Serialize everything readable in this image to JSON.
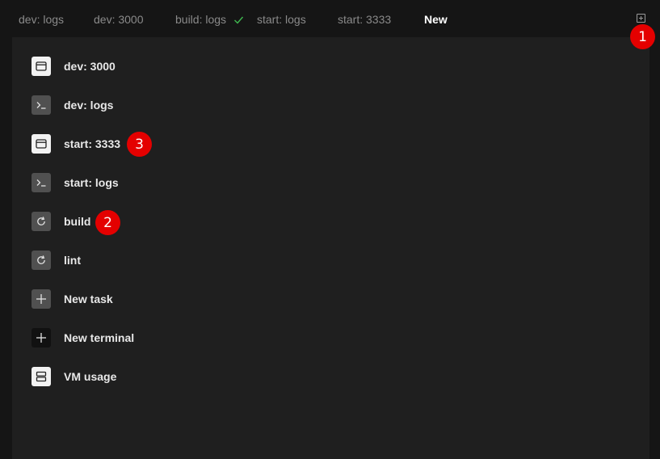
{
  "tabs": [
    {
      "label": "dev: logs"
    },
    {
      "label": "dev: 3000"
    },
    {
      "label": "build: logs"
    },
    {
      "label": "start: logs"
    },
    {
      "label": "start: 3333"
    },
    {
      "label": "New"
    }
  ],
  "active_tab": "New",
  "menu": {
    "items": [
      {
        "label": "dev: 3000",
        "icon": "browser-window-icon"
      },
      {
        "label": "dev: logs",
        "icon": "terminal-icon"
      },
      {
        "label": "start: 3333",
        "icon": "browser-window-icon"
      },
      {
        "label": "start: logs",
        "icon": "terminal-icon"
      },
      {
        "label": "build",
        "icon": "refresh-icon"
      },
      {
        "label": "lint",
        "icon": "refresh-icon"
      },
      {
        "label": "New task",
        "icon": "plus-icon"
      },
      {
        "label": "New terminal",
        "icon": "plus-icon"
      },
      {
        "label": "VM usage",
        "icon": "server-icon"
      }
    ]
  },
  "badges": [
    "1",
    "2",
    "3"
  ],
  "colors": {
    "background": "#151515",
    "panel": "#1f1f1f",
    "badge": "#e40000",
    "check": "#3fb950"
  }
}
